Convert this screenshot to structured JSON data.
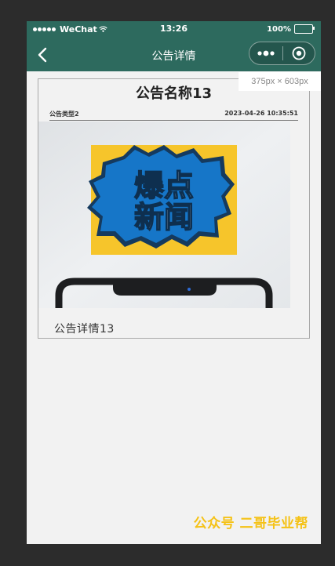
{
  "status_bar": {
    "carrier": "WeChat",
    "time": "13:26",
    "battery": "100%"
  },
  "nav": {
    "title": "公告详情"
  },
  "size_tip": "375px × 603px",
  "announcement": {
    "title": "公告名称13",
    "type": "公告类型2",
    "date": "2023-04-26 10:35:51",
    "banner_text_line1": "爆点",
    "banner_text_line2": "新闻",
    "detail": "公告详情13"
  },
  "watermark": "公众号 二哥毕业帮",
  "colors": {
    "nav_bg": "#2d6a5e",
    "page_bg": "#f2f2f2",
    "watermark": "#f5c216",
    "banner_blue": "#1676c8",
    "banner_yellow": "#f6c52b"
  }
}
